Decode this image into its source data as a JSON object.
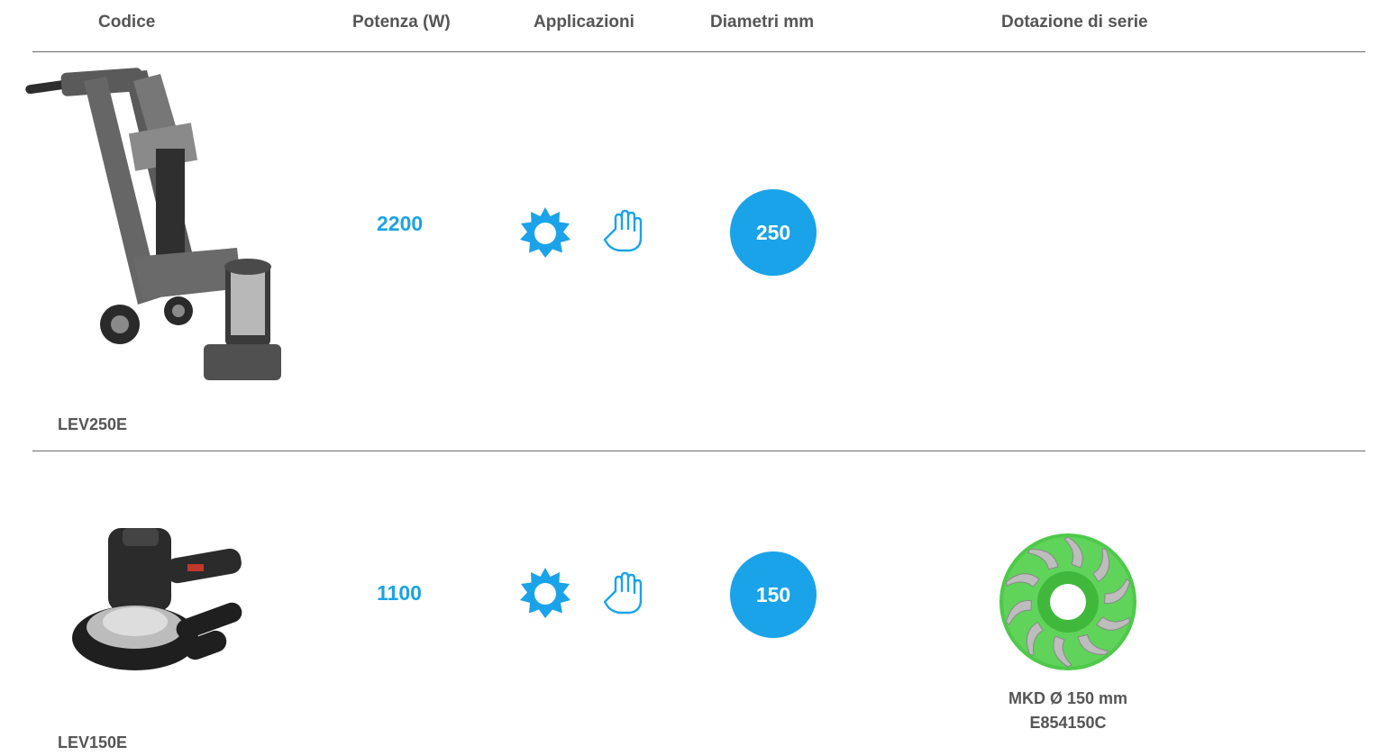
{
  "table": {
    "headers": {
      "code": "Codice",
      "power": "Potenza (W)",
      "applications": "Applicazioni",
      "diameters": "Diametri mm",
      "equipment": "Dotazione di serie"
    },
    "rows": [
      {
        "code": "LEV250E",
        "power": "2200",
        "applications": [
          "sun-icon",
          "hand-icon"
        ],
        "diameter": "250",
        "equipment": null
      },
      {
        "code": "LEV150E",
        "power": "1100",
        "applications": [
          "sun-icon",
          "hand-icon"
        ],
        "diameter": "150",
        "equipment": {
          "line1": "MKD Ø 150 mm",
          "line2": "E854150C"
        }
      }
    ]
  },
  "colors": {
    "accent": "#1aa3e8",
    "text": "#555555",
    "rule": "#6b6b6b",
    "accessory_green": "#4ec94a"
  }
}
